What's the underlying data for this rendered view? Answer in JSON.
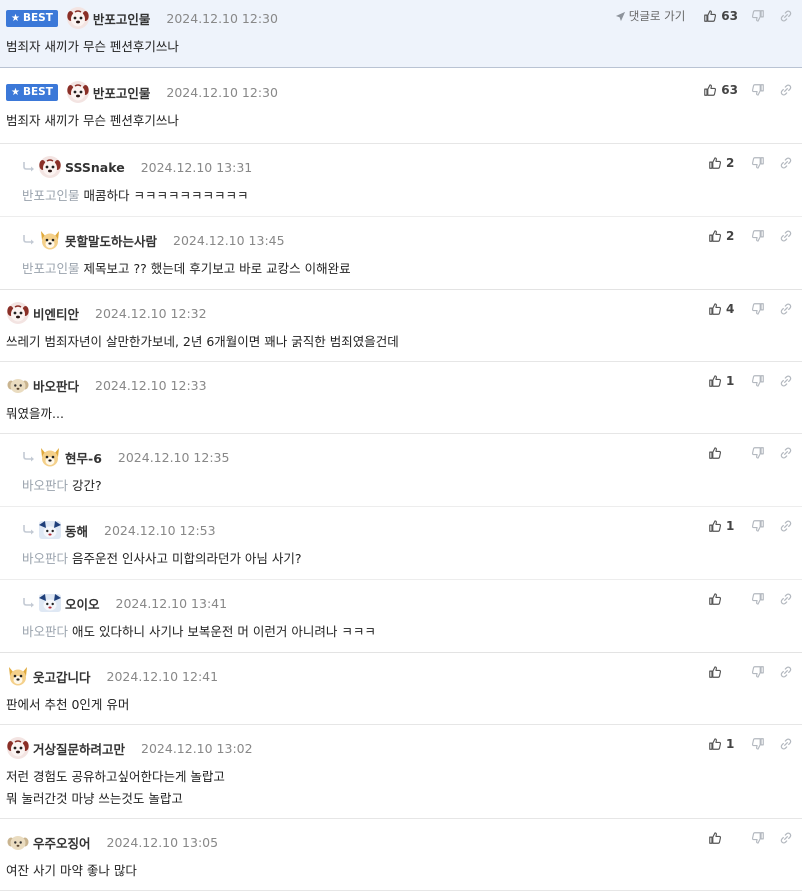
{
  "labels": {
    "best_badge": "BEST",
    "go_to_reply": "댓글로 가기"
  },
  "colors": {
    "best_badge_bg": "#3b78d8",
    "top_best_bg": "#eef3fb",
    "mention_text": "#9aa3ad"
  },
  "comments": [
    {
      "id": "c0",
      "nick": "반포고인물",
      "date": "2024.12.10 12:30",
      "likes": "63",
      "text": "범죄자 새끼가 무슨 펜션후기쓰나",
      "mention": "",
      "avatar": "dog-red"
    },
    {
      "id": "c1",
      "nick": "반포고인물",
      "date": "2024.12.10 12:30",
      "likes": "63",
      "text": "범죄자 새끼가 무슨 펜션후기쓰나",
      "mention": "",
      "avatar": "dog-red"
    },
    {
      "id": "c2",
      "nick": "SSSnake",
      "date": "2024.12.10 13:31",
      "likes": "2",
      "text": "매콤하다 ㅋㅋㅋㅋㅋㅋㅋㅋㅋㅋ",
      "mention": "반포고인물",
      "avatar": "dog-red"
    },
    {
      "id": "c3",
      "nick": "못할말도하는사람",
      "date": "2024.12.10 13:45",
      "likes": "2",
      "text": "제목보고 ?? 했는데 후기보고 바로 교캉스 이해완료",
      "mention": "반포고인물",
      "avatar": "dog-yellow"
    },
    {
      "id": "c4",
      "nick": "비엔티안",
      "date": "2024.12.10 12:32",
      "likes": "4",
      "text": "쓰레기 범죄자년이 살만한가보네, 2년 6개월이면 꽤나 굵직한 범죄였을건데",
      "mention": "",
      "avatar": "dog-red"
    },
    {
      "id": "c5",
      "nick": "바오판다",
      "date": "2024.12.10 12:33",
      "likes": "1",
      "text": "뭐였을까...",
      "mention": "",
      "avatar": "pup"
    },
    {
      "id": "c6",
      "nick": "현무-6",
      "date": "2024.12.10 12:35",
      "likes": "",
      "text": "강간?",
      "mention": "바오판다",
      "avatar": "dog-yellow"
    },
    {
      "id": "c7",
      "nick": "동해",
      "date": "2024.12.10 12:53",
      "likes": "1",
      "text": "음주운전 인사사고 미합의라던가 아님 사기?",
      "mention": "바오판다",
      "avatar": "blue"
    },
    {
      "id": "c8",
      "nick": "오이오",
      "date": "2024.12.10 13:41",
      "likes": "",
      "text": "애도 있다하니 사기나 보복운전 머 이런거 아니려나 ㅋㅋㅋ",
      "mention": "바오판다",
      "avatar": "blue"
    },
    {
      "id": "c9",
      "nick": "웃고갑니다",
      "date": "2024.12.10 12:41",
      "likes": "",
      "text": "판에서 추천 0인게 유머",
      "mention": "",
      "avatar": "dog-yellow"
    },
    {
      "id": "c10",
      "nick": "거상질문하려고만",
      "date": "2024.12.10 13:02",
      "likes": "1",
      "text": "저런 경험도 공유하고싶어한다는게 놀랍고\n뭐 눌러간것 마냥 쓰는것도 놀랍고",
      "mention": "",
      "avatar": "dog-red"
    },
    {
      "id": "c11",
      "nick": "우주오징어",
      "date": "2024.12.10 13:05",
      "likes": "",
      "text": "여잔 사기 마약 좋나 많다",
      "mention": "",
      "avatar": "pup"
    }
  ]
}
